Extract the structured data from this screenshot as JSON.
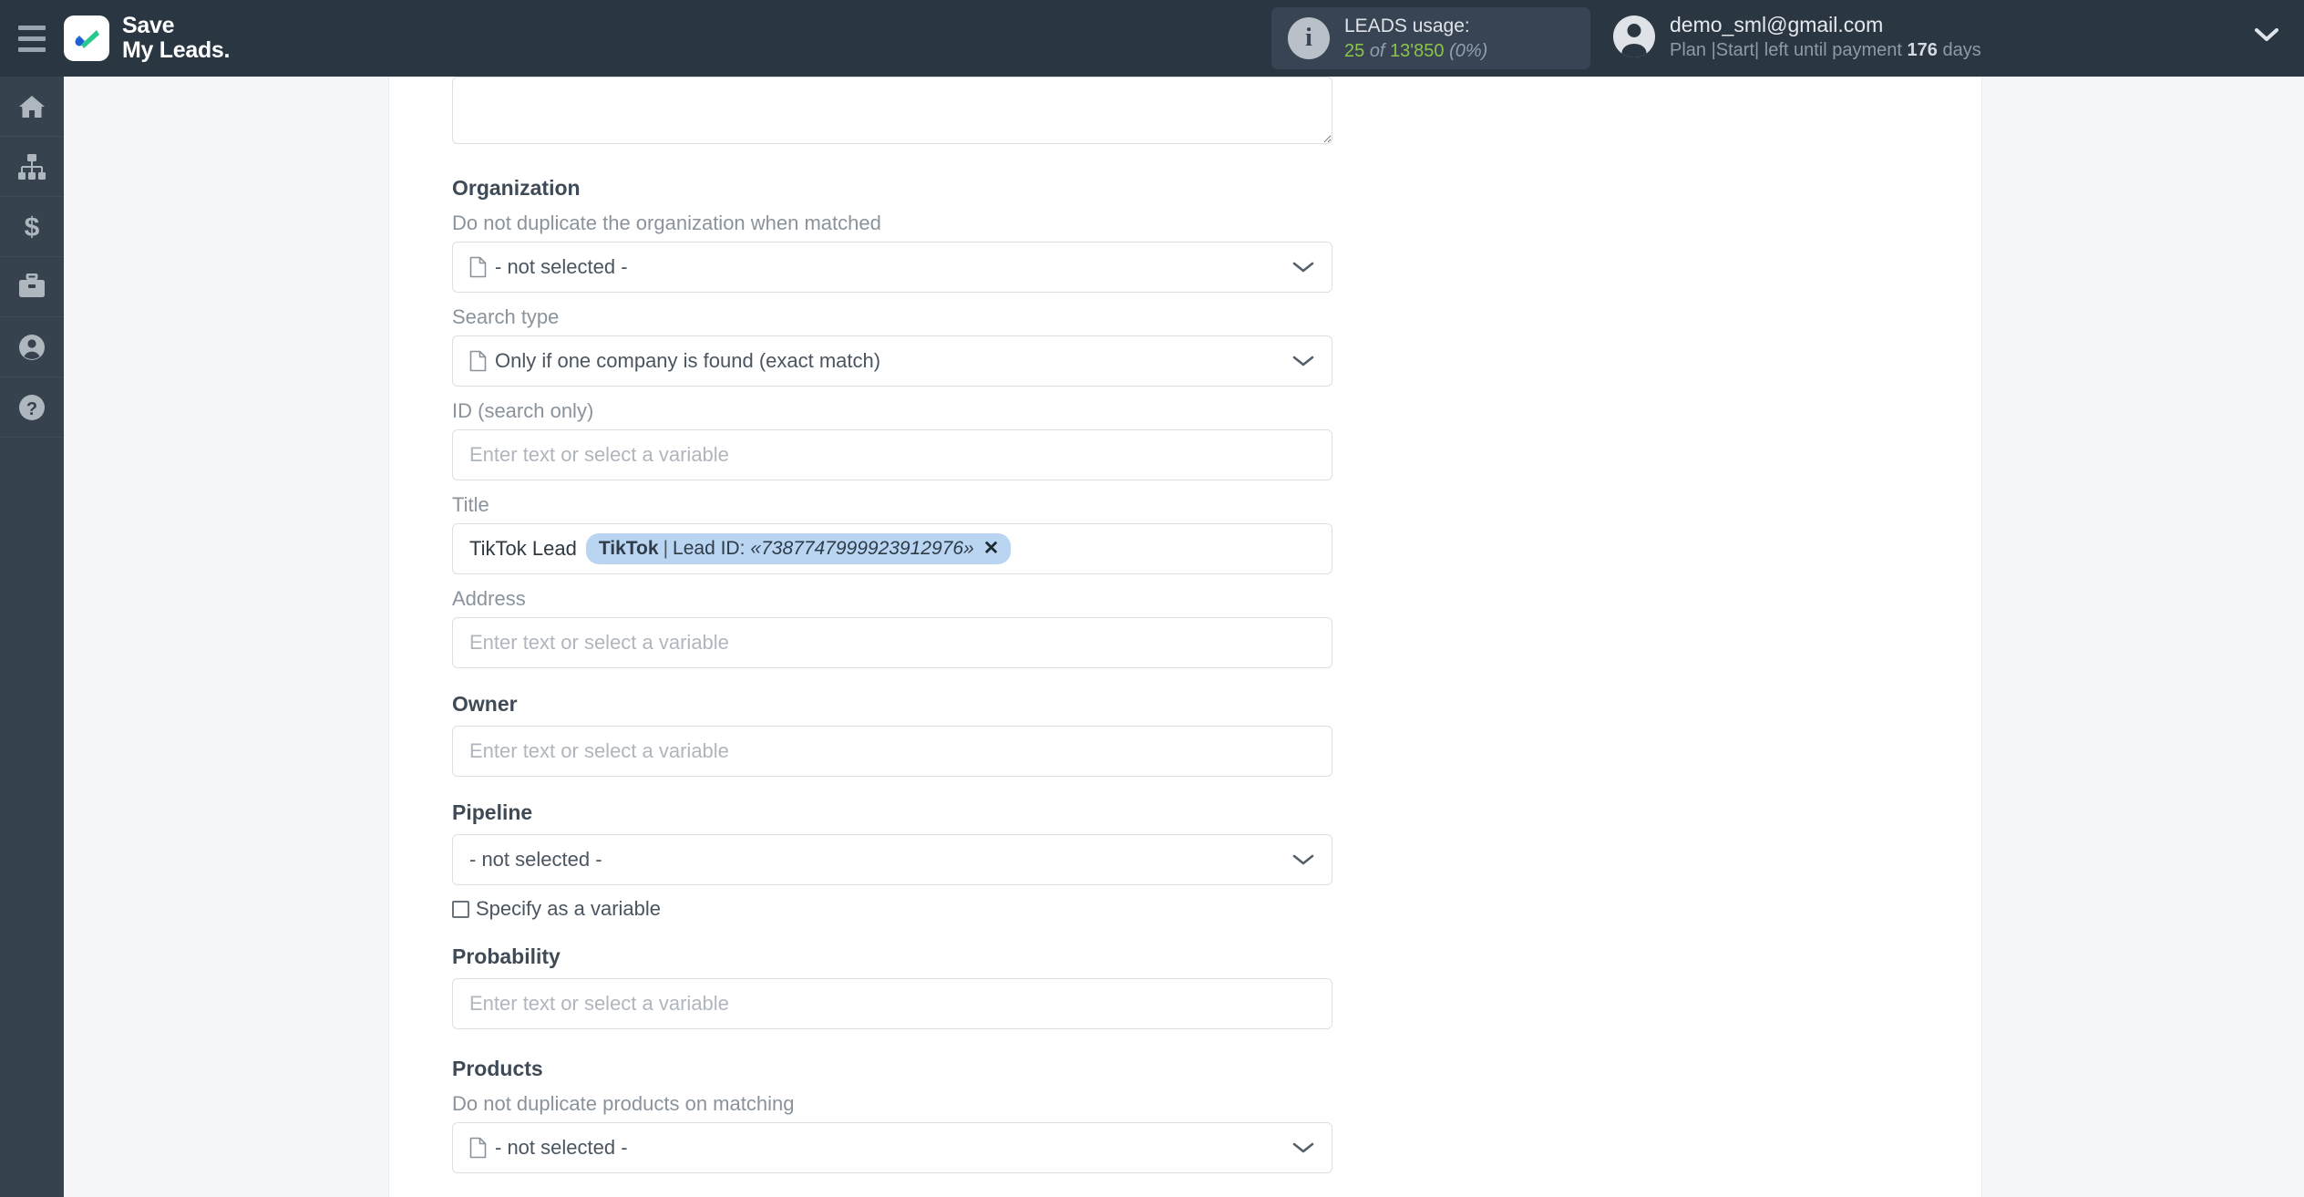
{
  "topbar": {
    "menu_icon": "hamburger-icon",
    "brand_line1": "Save",
    "brand_line2": "My Leads.",
    "usage": {
      "icon": "info-icon",
      "title": "LEADS usage:",
      "used": "25",
      "of": "of",
      "total": "13'850",
      "percent": "(0%)"
    },
    "account": {
      "avatar_icon": "user-avatar-icon",
      "email": "demo_sml@gmail.com",
      "plan_prefix": "Plan |Start| left until payment",
      "plan_days": "176",
      "plan_suffix": "days",
      "chevron_icon": "chevron-down-icon"
    }
  },
  "sidebar": {
    "items": [
      {
        "name": "home",
        "icon": "home-icon"
      },
      {
        "name": "connections",
        "icon": "sitemap-icon"
      },
      {
        "name": "billing",
        "icon": "dollar-icon"
      },
      {
        "name": "services",
        "icon": "briefcase-icon"
      },
      {
        "name": "profile",
        "icon": "user-circle-icon"
      },
      {
        "name": "help",
        "icon": "question-circle-icon"
      }
    ]
  },
  "form": {
    "placeholder": "Enter text or select a variable",
    "not_selected": "- not selected -",
    "organization": {
      "section_title": "Organization",
      "dedupe_label": "Do not duplicate the organization when matched",
      "dedupe_value": "- not selected -",
      "search_type_label": "Search type",
      "search_type_value": "Only if one company is found (exact match)",
      "id_label": "ID (search only)",
      "id_value": "",
      "title_label": "Title",
      "title_text": "TikTok Lead",
      "title_tag_source": "TikTok",
      "title_tag_sep": "|",
      "title_tag_field": "Lead ID:",
      "title_tag_value": "«7387747999923912976»",
      "title_tag_remove": "✕",
      "address_label": "Address",
      "address_value": "",
      "owner_label": "Owner",
      "owner_value": "",
      "pipeline_label": "Pipeline",
      "pipeline_value": "- not selected -",
      "pipeline_checkbox_label": "Specify as a variable",
      "probability_label": "Probability",
      "probability_value": ""
    },
    "products": {
      "section_title": "Products",
      "dedupe_label": "Do not duplicate products on matching",
      "dedupe_value": "- not selected -"
    }
  },
  "colors": {
    "topbar": "#2b3643",
    "sidebar": "#37424f",
    "page_bg": "#f4f6fa",
    "tag_bg": "#b9d5f2",
    "usage_green": "#8bc34a"
  }
}
